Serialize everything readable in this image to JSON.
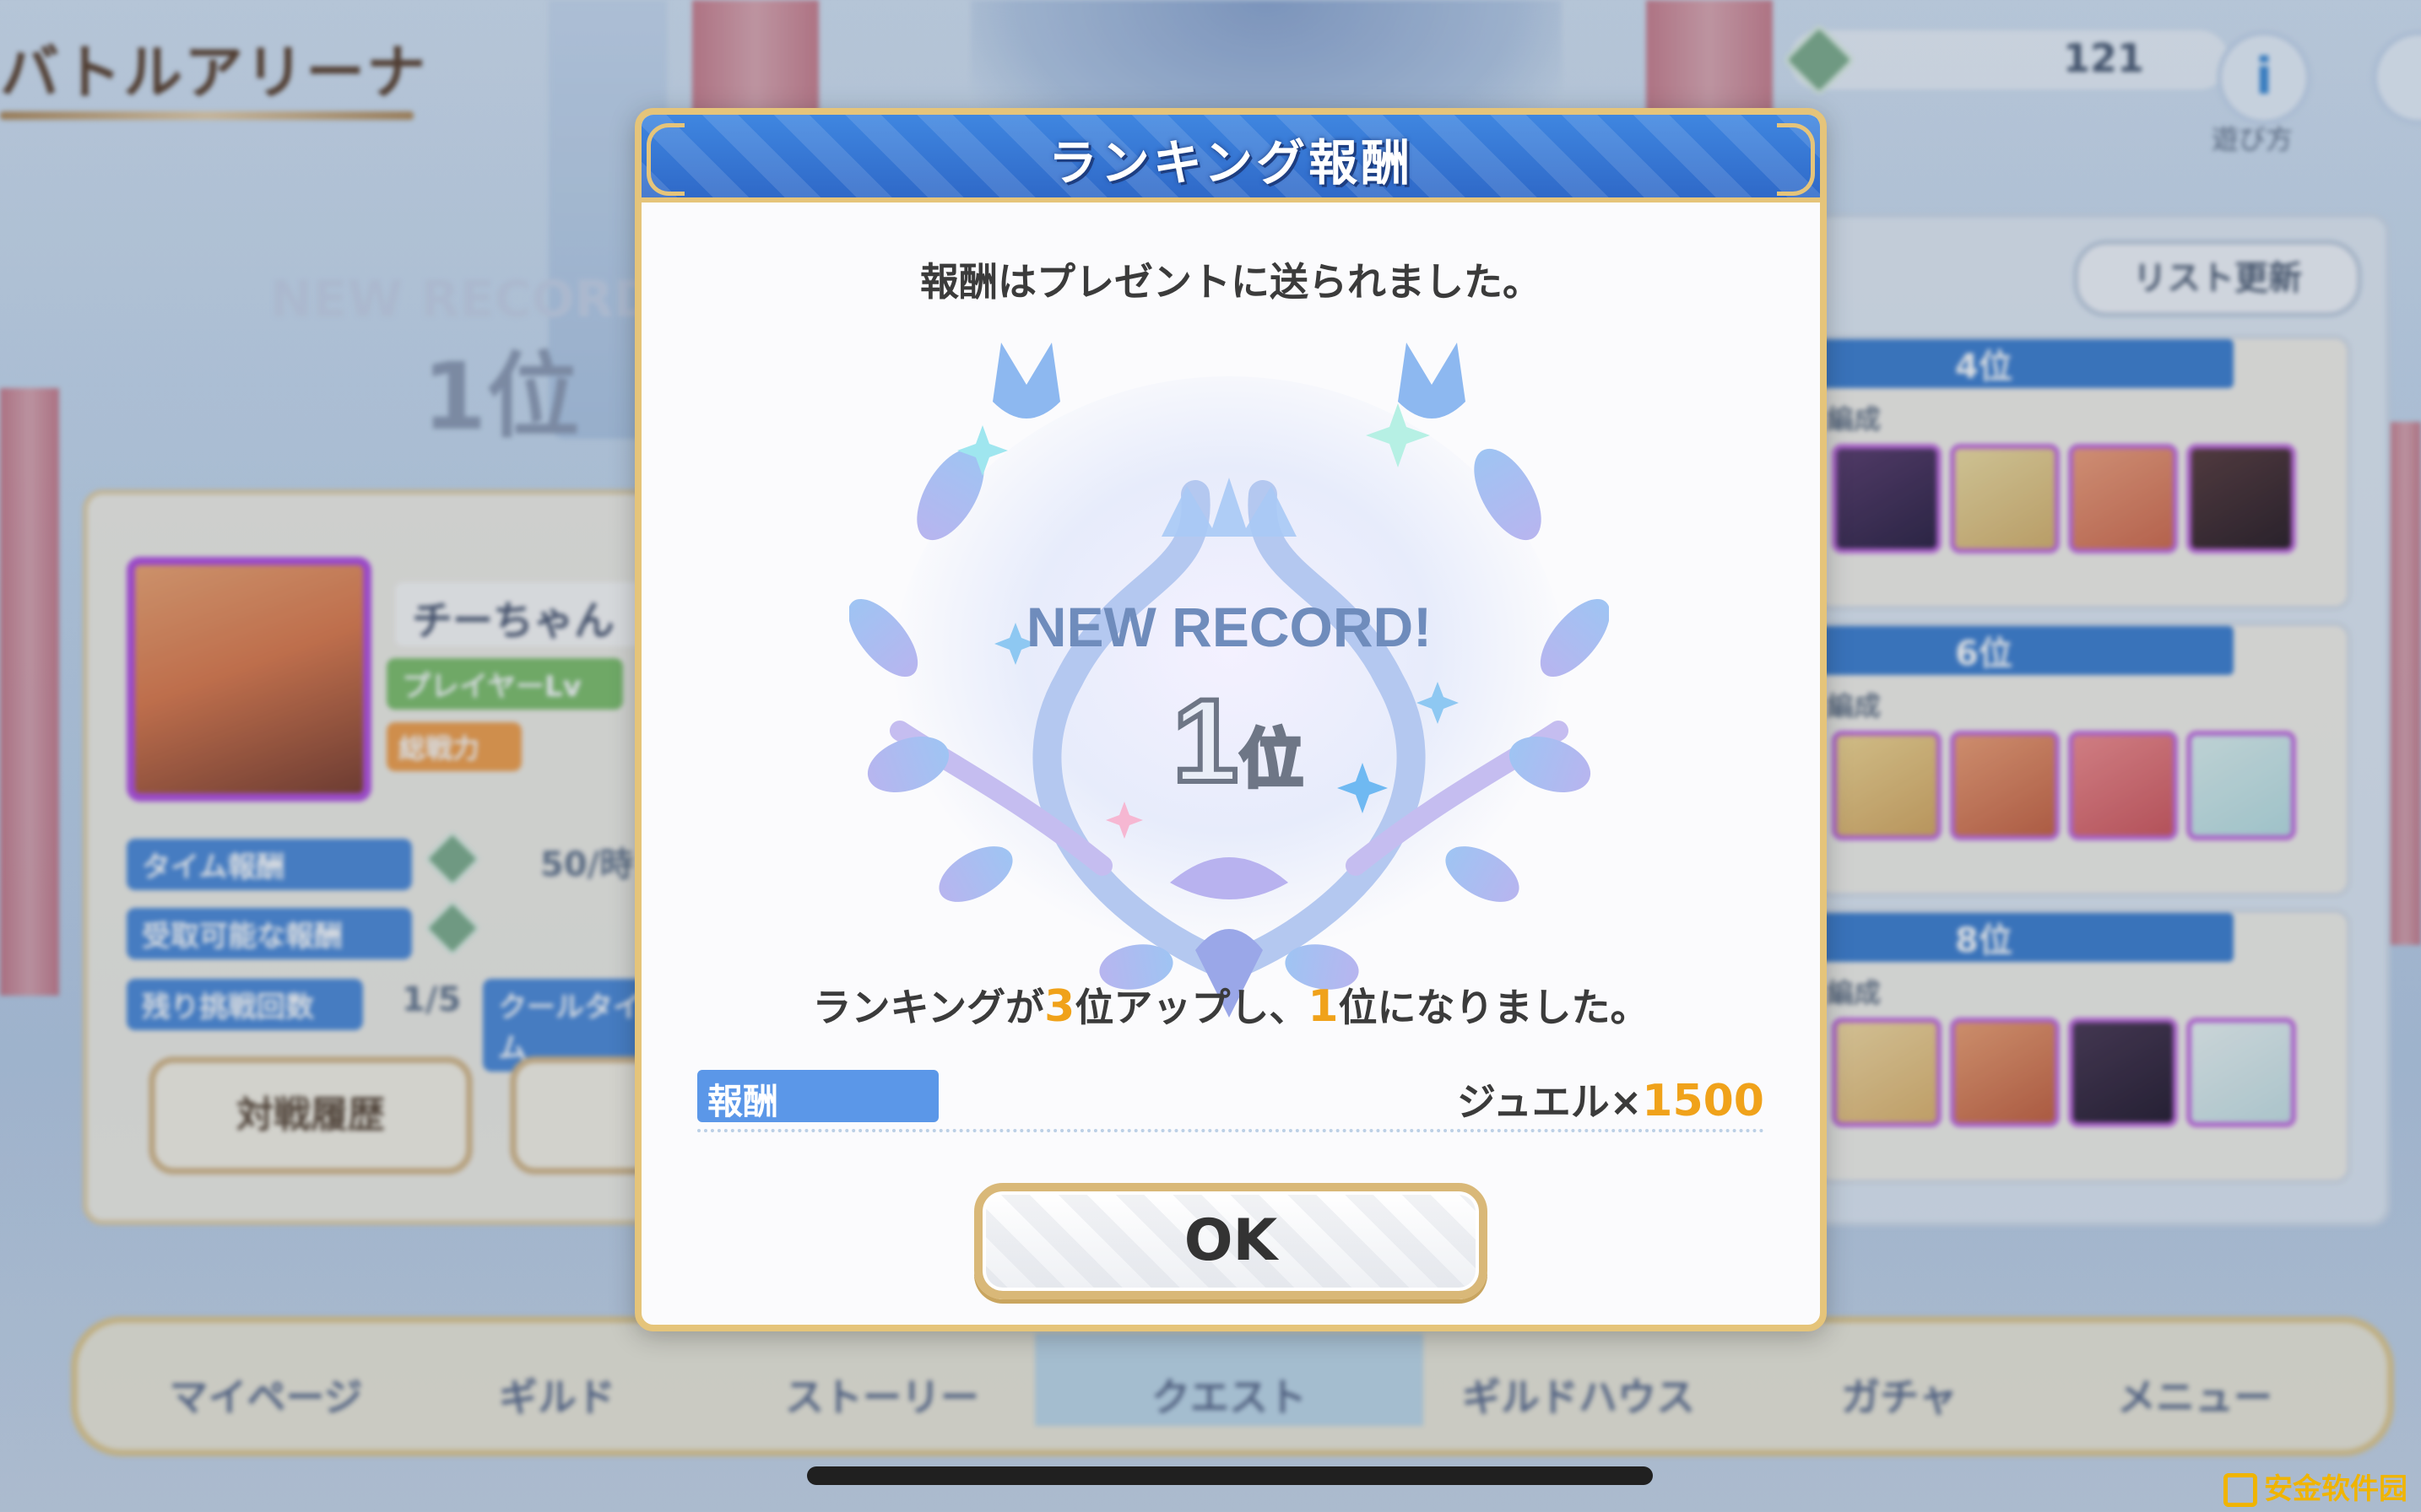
{
  "background": {
    "arena_title": "バトルアリーナ",
    "currency_count": "121",
    "help_button_label": "遊び方",
    "list_refresh_label": "リスト更新",
    "record_title": "NEW RECORD!",
    "record_rank": "1位",
    "player_name": "チーちゃん",
    "player_level_label": "プレイヤーLv",
    "power_label": "総戦力",
    "time_reward_label": "タイム報酬",
    "time_reward_value": "50/時",
    "receivable_reward_label": "受取可能な報酬",
    "remaining_challenges_label": "残り挑戦回数",
    "remaining_challenges_value": "1/5",
    "cooldown_label": "クールタイム",
    "history_button": "対戦履歴",
    "team_label": "編成",
    "opponents": [
      {
        "rank": "4位"
      },
      {
        "rank": "6位"
      },
      {
        "rank": "8位"
      }
    ],
    "footer_tabs": [
      "マイページ",
      "ギルド",
      "ストーリー",
      "クエスト",
      "ギルドハウス",
      "ガチャ",
      "メニュー"
    ]
  },
  "modal": {
    "title": "ランキング報酬",
    "sent_message": "報酬はプレゼントに送られました。",
    "emblem_text": "NEW RECORD!",
    "emblem_rank_number": "1",
    "emblem_rank_suffix": "位",
    "rank_msg_prefix": "ランキングが",
    "rank_up_amount": "3",
    "rank_msg_middle": "位アップし、",
    "new_rank": "1",
    "rank_msg_suffix": "位になりました。",
    "reward_label": "報酬",
    "reward_item": "ジュエル×",
    "reward_amount": "1500",
    "ok_label": "OK"
  },
  "watermark": "安金软件园",
  "colors": {
    "header_blue": "#2f69c8",
    "gold_border": "#e5c47a",
    "highlight_orange": "#f0a21a",
    "reward_tag_blue": "#5b97e8"
  }
}
